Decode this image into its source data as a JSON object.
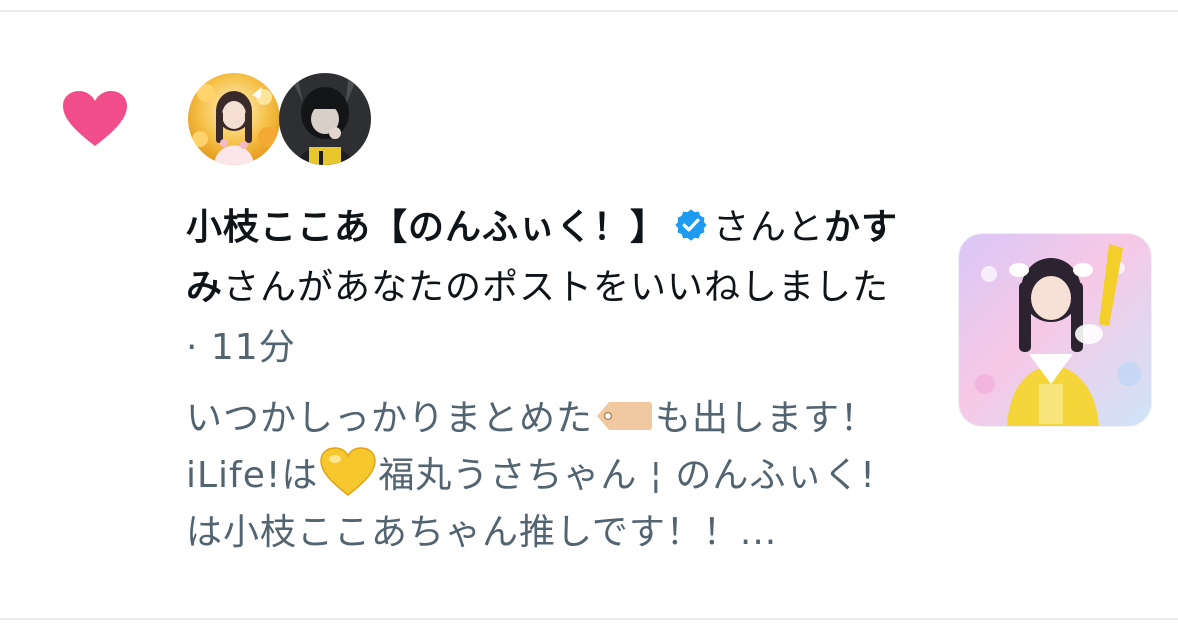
{
  "notification": {
    "type_icon": "heart-icon",
    "icon_color": "#f91880",
    "avatars": [
      {
        "icon": "avatar-user-1"
      },
      {
        "icon": "avatar-user-2"
      }
    ],
    "user1_name": "小枝ここあ【のんふぃく！】",
    "verified_icon": "verified-badge-icon",
    "connector": "さんと",
    "user2_name": "かすみ",
    "action_text": "さんがあなたのポストをいいねしました",
    "separator": " · ",
    "time": "11分",
    "post_preview": {
      "part1": "いつかしっかりまとめた",
      "tag_emoji": "label-tag-icon",
      "part2": "も出します！",
      "part3": "iLife!は",
      "yellow_heart_emoji": "yellow-heart-icon",
      "part4": "福丸うさちゃん ¦ のんふぃく!は小枝ここあちゃん推しです！！..."
    },
    "thumbnail_icon": "post-image-thumbnail"
  },
  "colors": {
    "heart": "#f91880",
    "verified": "#1d9bf0",
    "primary_text": "#0f1419",
    "secondary_text": "#536471",
    "divider": "#e7e9ec"
  }
}
